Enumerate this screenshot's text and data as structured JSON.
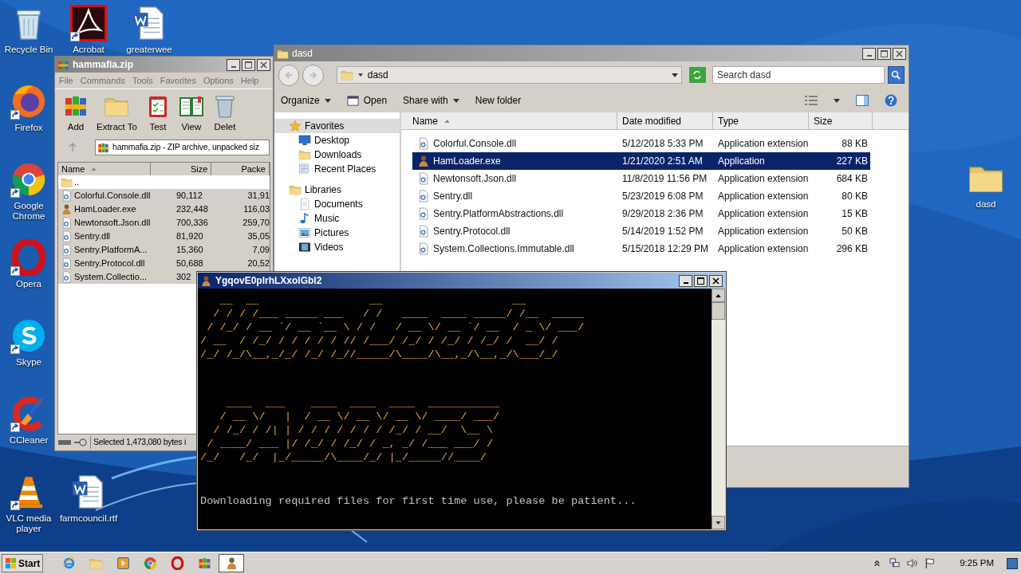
{
  "desktop_icons": [
    {
      "label": "Recycle Bin",
      "kind": "recycle",
      "shortcut": false
    },
    {
      "label": "Acrobat",
      "kind": "pdf",
      "shortcut": true
    },
    {
      "label": "greaterwee",
      "kind": "word",
      "shortcut": false
    },
    {
      "label": "Firefox",
      "kind": "firefox",
      "shortcut": true
    },
    {
      "label": "Google Chrome",
      "kind": "chrome",
      "shortcut": true
    },
    {
      "label": "Opera",
      "kind": "opera",
      "shortcut": true
    },
    {
      "label": "Skype",
      "kind": "skype",
      "shortcut": true
    },
    {
      "label": "CCleaner",
      "kind": "ccleaner",
      "shortcut": true
    },
    {
      "label": "VLC media player",
      "kind": "vlc",
      "shortcut": true
    },
    {
      "label": "farmcouncil.rtf",
      "kind": "word",
      "shortcut": false
    },
    {
      "label": "dasd",
      "kind": "folder",
      "shortcut": false
    }
  ],
  "winrar": {
    "title": "hammafia.zip",
    "active": false,
    "menu": [
      "File",
      "Commands",
      "Tools",
      "Favorites",
      "Options",
      "Help"
    ],
    "toolbar": [
      {
        "label": "Add",
        "kind": "add"
      },
      {
        "label": "Extract To",
        "kind": "extract"
      },
      {
        "label": "Test",
        "kind": "test"
      },
      {
        "label": "View",
        "kind": "view"
      },
      {
        "label": "Delet",
        "kind": "delete"
      }
    ],
    "address": "hammafia.zip - ZIP archive, unpacked siz",
    "columns": [
      {
        "label": "Name",
        "sorted": true
      },
      {
        "label": "Size",
        "sorted": false
      },
      {
        "label": "Packe",
        "sorted": false
      }
    ],
    "rows": [
      {
        "name": "..",
        "kind": "up",
        "selected": false
      },
      {
        "name": "Colorful.Console.dll",
        "kind": "dll",
        "size": "90,112",
        "packed": "31,91",
        "selected": true
      },
      {
        "name": "HamLoader.exe",
        "kind": "exe",
        "size": "232,448",
        "packed": "116,03",
        "selected": true
      },
      {
        "name": "Newtonsoft.Json.dll",
        "kind": "dll",
        "size": "700,336",
        "packed": "259,70",
        "selected": true
      },
      {
        "name": "Sentry.dll",
        "kind": "dll",
        "size": "81,920",
        "packed": "35,05",
        "selected": true
      },
      {
        "name": "Sentry.PlatformA...",
        "kind": "dll",
        "size": "15,360",
        "packed": "7,09",
        "selected": true
      },
      {
        "name": "Sentry.Protocol.dll",
        "kind": "dll",
        "size": "50,688",
        "packed": "20,52",
        "selected": true
      },
      {
        "name": "System.Collectio...",
        "kind": "dll",
        "size": "302",
        "selected": true
      }
    ],
    "status": "Selected 1,473,080 bytes i"
  },
  "explorer": {
    "title": "dasd",
    "active": false,
    "path": "dasd",
    "search": {
      "placeholder": "Search dasd"
    },
    "toolbar": [
      {
        "label": "Organize",
        "kind": "menu",
        "dropdown": true
      },
      {
        "label": "Open",
        "kind": "open",
        "dropdown": false
      },
      {
        "label": "Share with",
        "kind": "menu",
        "dropdown": true
      },
      {
        "label": "New folder",
        "kind": "menu",
        "dropdown": false
      }
    ],
    "nav": [
      {
        "label": "Favorites",
        "kind": "star",
        "selected": true,
        "children": [
          {
            "label": "Desktop",
            "kind": "desktop",
            "selected": false
          },
          {
            "label": "Downloads",
            "kind": "downloads",
            "selected": false
          },
          {
            "label": "Recent Places",
            "kind": "recent",
            "selected": false
          }
        ]
      },
      {
        "label": "Libraries",
        "kind": "libraries",
        "selected": false,
        "children": [
          {
            "label": "Documents",
            "kind": "documents",
            "selected": false
          },
          {
            "label": "Music",
            "kind": "music",
            "selected": false
          },
          {
            "label": "Pictures",
            "kind": "pictures",
            "selected": false
          },
          {
            "label": "Videos",
            "kind": "videos",
            "selected": false
          }
        ]
      }
    ],
    "columns": [
      {
        "label": "Name",
        "sorted": true
      },
      {
        "label": "Date modified",
        "sorted": false
      },
      {
        "label": "Type",
        "sorted": false
      },
      {
        "label": "Size",
        "sorted": false
      }
    ],
    "rows": [
      {
        "name": "Colorful.Console.dll",
        "kind": "dll",
        "date": "5/12/2018 5:33 PM",
        "type": "Application extension",
        "size": "88 KB",
        "selected": false
      },
      {
        "name": "HamLoader.exe",
        "kind": "exe",
        "date": "1/21/2020 2:51 AM",
        "type": "Application",
        "size": "227 KB",
        "selected": true
      },
      {
        "name": "Newtonsoft.Json.dll",
        "kind": "dll",
        "date": "11/8/2019 11:56 PM",
        "type": "Application extension",
        "size": "684 KB",
        "selected": false
      },
      {
        "name": "Sentry.dll",
        "kind": "dll",
        "date": "5/23/2019 6:08 PM",
        "type": "Application extension",
        "size": "80 KB",
        "selected": false
      },
      {
        "name": "Sentry.PlatformAbstractions.dll",
        "kind": "dll",
        "date": "9/29/2018 2:36 PM",
        "type": "Application extension",
        "size": "15 KB",
        "selected": false
      },
      {
        "name": "Sentry.Protocol.dll",
        "kind": "dll",
        "date": "5/14/2019 1:52 PM",
        "type": "Application extension",
        "size": "50 KB",
        "selected": false
      },
      {
        "name": "System.Collections.Immutable.dll",
        "kind": "dll",
        "date": "5/15/2018 12:29 PM",
        "type": "Application extension",
        "size": "296 KB",
        "selected": false
      }
    ]
  },
  "console": {
    "title": "YgqovE0plrhLXxolGbl2",
    "active": true,
    "art": [
      [
        "   __  __                 __                    __",
        "  / / / /___ _____ ___   / /   ____  ____ _____/ /__  _____",
        " / /_/ / __ `/ __ `__ \\ / /   / __ \\/ __ `/ __  / _ \\/ ___/",
        "/ __  / /_/ / / / / / // /___/ /_/ / /_/ / /_/ /  __/ /",
        "/_/ /_/\\__,_/_/ /_/ /_//_____/\\____/\\__,_/\\__,_/\\___/_/"
      ],
      [
        "    ____  ___    ____  ____  ____  ___________",
        "   / __ \\/   |  / __ \\/ __ \\/ __ \\/ ____/ ___/",
        "  / /_/ / /| | / / / / / / / /_/ / __/  \\__ \\",
        " / ____/ ___ |/ /_/ / /_/ / _, _/ /___ ___/ /",
        "/_/   /_/  |_/_____/\\____/_/ |_/_____//____/"
      ]
    ],
    "message": "Downloading required files for first time use, please be patient..."
  },
  "taskbar": {
    "start": "Start",
    "items": [
      {
        "kind": "ie",
        "selected": false
      },
      {
        "kind": "explorer",
        "selected": false
      },
      {
        "kind": "media",
        "selected": false
      },
      {
        "kind": "chrome",
        "selected": false
      },
      {
        "kind": "opera",
        "selected": false
      },
      {
        "kind": "winrar",
        "selected": false
      },
      {
        "kind": "exe",
        "selected": true
      }
    ],
    "tray": [
      {
        "kind": "chevron"
      },
      {
        "kind": "network"
      },
      {
        "kind": "volume"
      },
      {
        "kind": "flag"
      }
    ],
    "clock": "9:25 PM"
  }
}
